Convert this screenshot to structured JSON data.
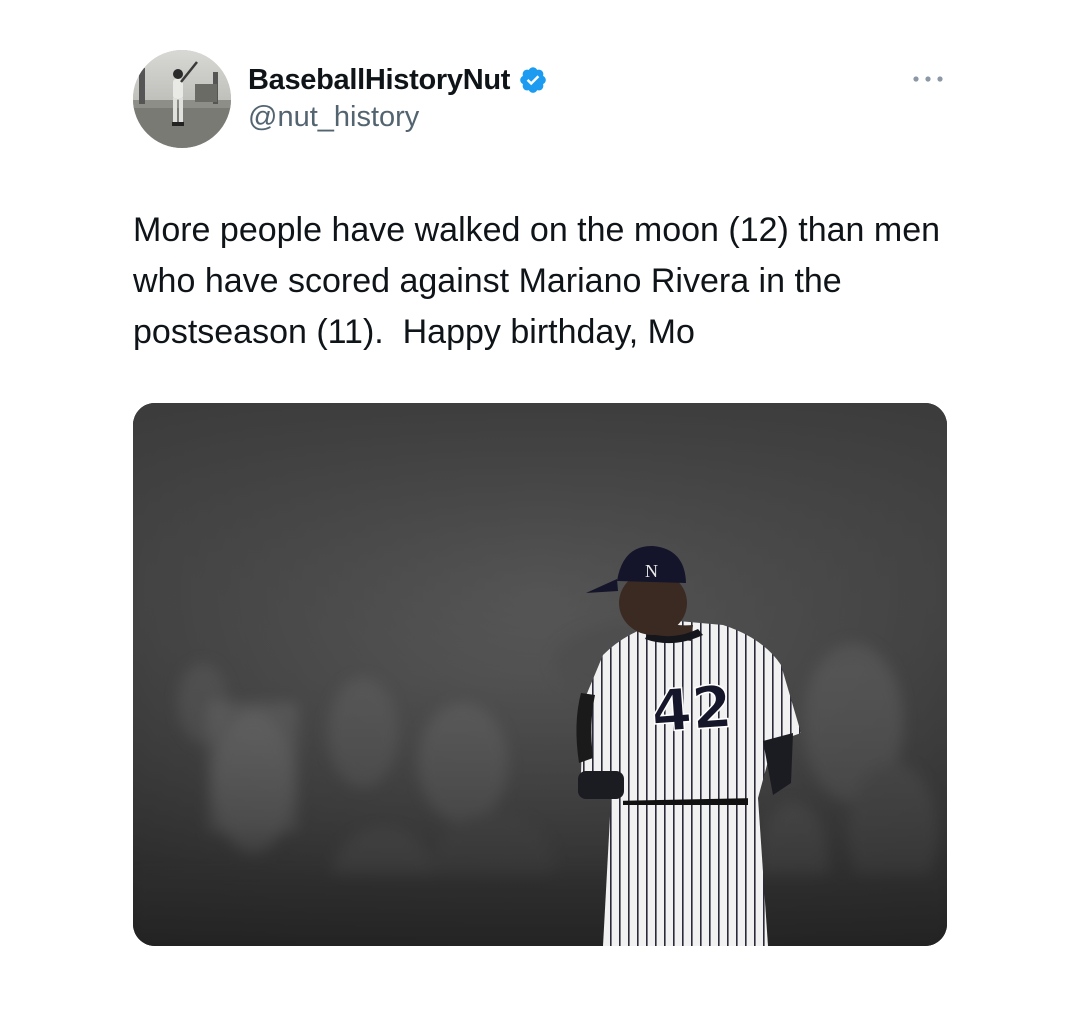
{
  "author": {
    "display_name": "BaseballHistoryNut",
    "handle": "@nut_history",
    "verified": true,
    "verified_color": "#1d9bf0",
    "avatar_icon": "profile-photo-batter"
  },
  "menu": {
    "icon": "more-options-icon"
  },
  "tweet": {
    "text": "More people have walked on the moon (12) than men who have scored against Mariano Rivera in the postseason (11).  Happy birthday, Mo"
  },
  "media": {
    "jersey_number": "42",
    "description_icon": "photo-pitcher-back"
  },
  "colors": {
    "text_primary": "#0f1419",
    "text_secondary": "#536471",
    "accent": "#1d9bf0"
  }
}
